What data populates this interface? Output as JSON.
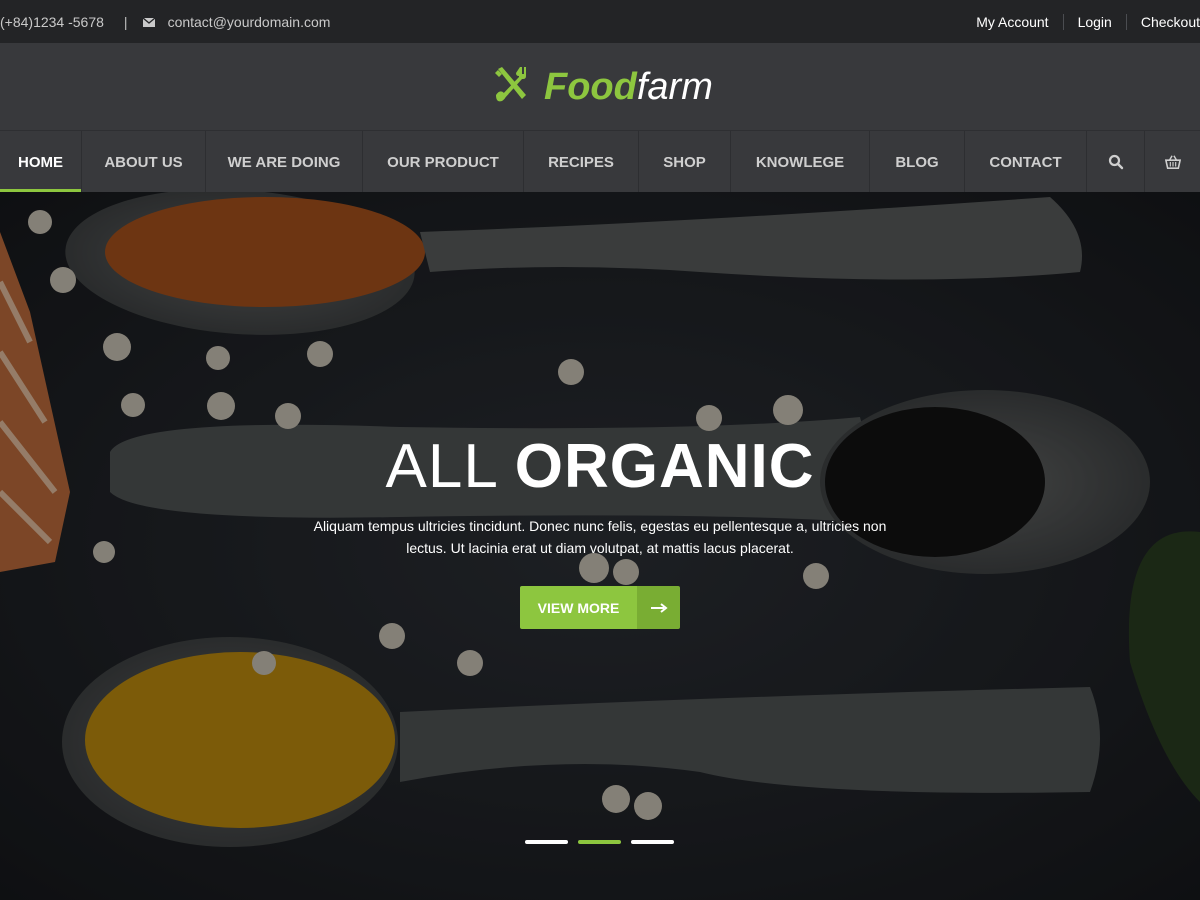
{
  "topbar": {
    "phone": "(+84)1234 -5678",
    "separator": "|",
    "email": "contact@yourdomain.com",
    "links": [
      "My Account",
      "Login",
      "Checkout"
    ]
  },
  "logo": {
    "word_bold": "Food",
    "word_light": "farm",
    "icon": "shovel-fork-icon"
  },
  "nav": {
    "items": [
      "HOME",
      "ABOUT US",
      "WE ARE DOING",
      "OUR PRODUCT",
      "RECIPES",
      "SHOP",
      "KNOWLEGE",
      "BLOG",
      "CONTACT"
    ],
    "active_index": 0,
    "icons": [
      "search-icon",
      "basket-icon"
    ]
  },
  "hero": {
    "title_light": "ALL",
    "title_bold": "ORGANIC",
    "description": "Aliquam tempus ultricies tincidunt. Donec nunc felis, egestas eu pellentesque a, ultricies non lectus. Ut lacinia erat ut diam volutpat, at mattis lacus placerat.",
    "button_label": "VIEW MORE",
    "slides_count": 3,
    "active_slide": 1
  },
  "colors": {
    "accent": "#8dc63f",
    "topbar": "#232426",
    "header": "#38393c"
  }
}
